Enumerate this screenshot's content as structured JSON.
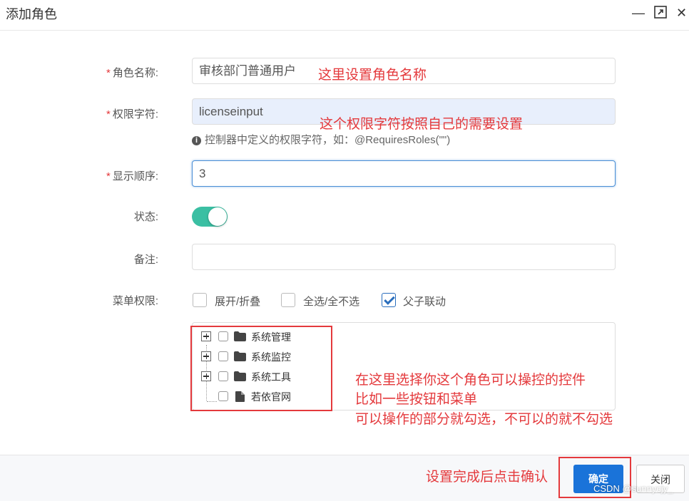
{
  "window": {
    "title": "添加角色",
    "minimize": "—",
    "maximize": "⤢",
    "close": "✕"
  },
  "form": {
    "role_name": {
      "required": "*",
      "label": "角色名称:",
      "value": "审核部门普通用户"
    },
    "perm_key": {
      "required": "*",
      "label": "权限字符:",
      "value": "licenseinput",
      "help_icon": "i",
      "help": "控制器中定义的权限字符，如：@RequiresRoles(\"\")"
    },
    "order": {
      "required": "*",
      "label": "显示顺序:",
      "value": "3"
    },
    "status": {
      "label": "状态:",
      "enabled": true
    },
    "remark": {
      "label": "备注:",
      "value": ""
    },
    "menu_perm": {
      "label": "菜单权限:",
      "options": [
        {
          "label": "展开/折叠",
          "checked": false
        },
        {
          "label": "全选/全不选",
          "checked": false
        },
        {
          "label": "父子联动",
          "checked": true
        }
      ],
      "tree": [
        {
          "label": "系统管理",
          "icon": "folder-icon",
          "expandable": true
        },
        {
          "label": "系统监控",
          "icon": "folder-icon",
          "expandable": true
        },
        {
          "label": "系统工具",
          "icon": "folder-icon",
          "expandable": true
        },
        {
          "label": "若依官网",
          "icon": "file-icon",
          "expandable": false
        }
      ]
    }
  },
  "annotations": {
    "name": "这里设置角色名称",
    "perm": "这个权限字符按照自己的需要设置",
    "tree_line1": "在这里选择你这个角色可以操控的控件",
    "tree_line2": "比如一些按钮和菜单",
    "tree_line3": "可以操作的部分就勾选，不可以的就不勾选",
    "footer": "设置完成后点击确认"
  },
  "footer": {
    "confirm": "确定",
    "close": "关闭"
  },
  "watermark": "CSDN @sunnycjy_",
  "colors": {
    "accent": "#1a73d9",
    "toggle": "#3bbfa3",
    "annotation": "#e4393c"
  }
}
